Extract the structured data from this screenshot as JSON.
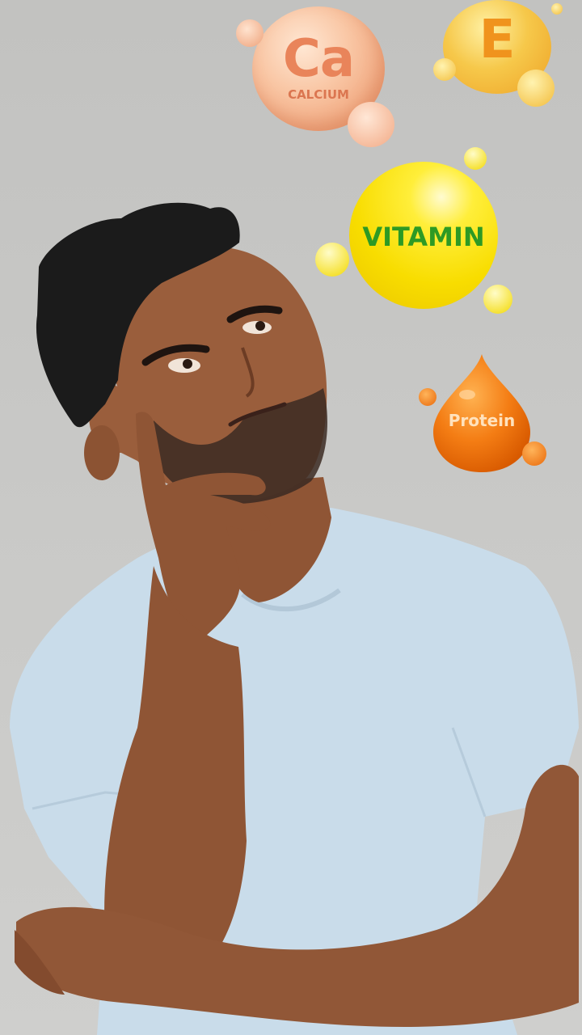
{
  "bubbles": {
    "calcium": {
      "symbol": "Ca",
      "name": "CALCIUM"
    },
    "vitamin_e": {
      "symbol": "E"
    },
    "vitamin": {
      "label": "VITAMIN"
    },
    "protein": {
      "label": "Protein"
    }
  },
  "colors": {
    "background": "#c6c6c4",
    "calcium": "#f0a47b",
    "vitamin_e": "#f6c84a",
    "vitamin": "#f8dd00",
    "vitamin_text": "#2d9a24",
    "protein": "#ee6a0c",
    "shirt": "#c9dcea",
    "skin": "#9a5e3c",
    "hair": "#1b1b1b"
  }
}
